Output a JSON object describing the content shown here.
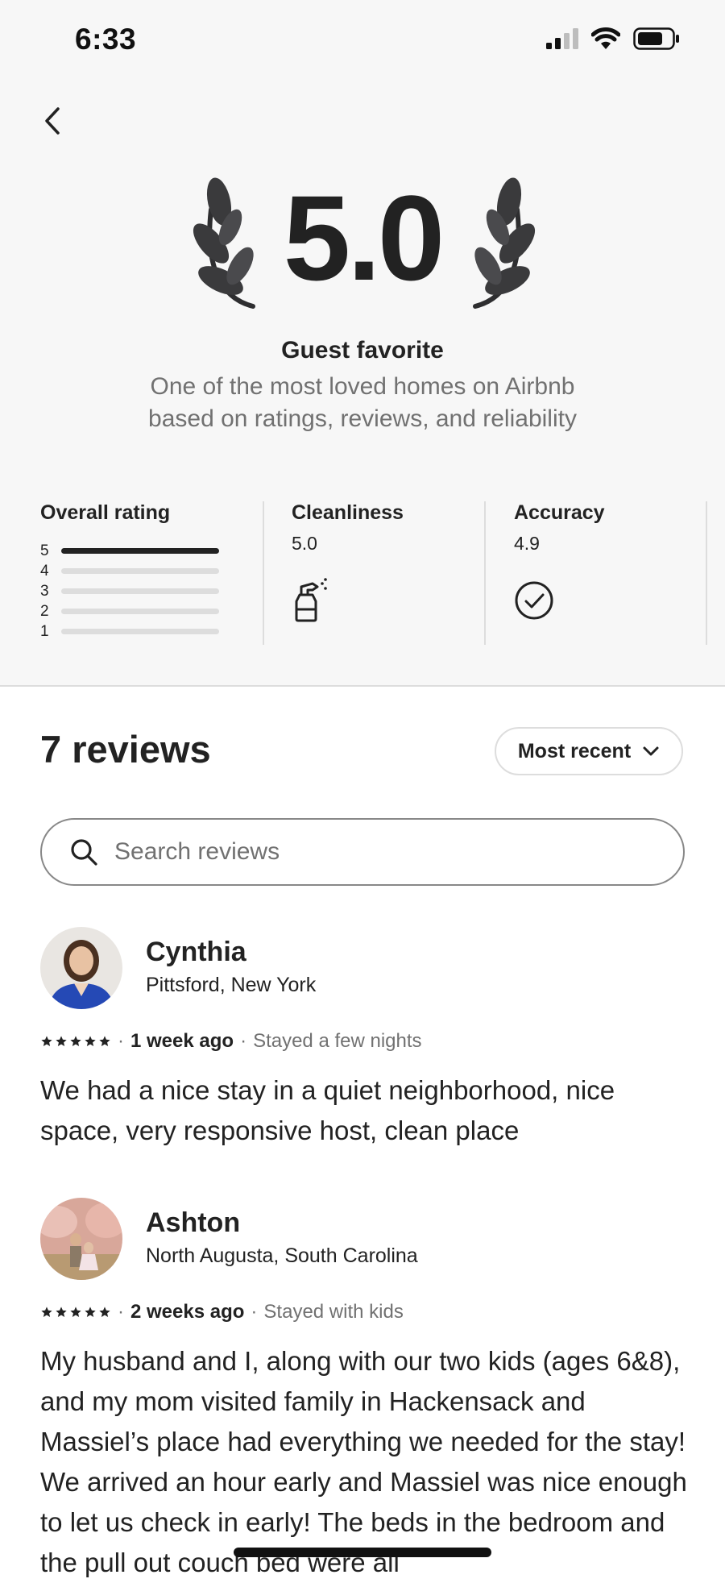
{
  "status_bar": {
    "time": "6:33"
  },
  "header": {
    "rating": "5.0",
    "badge_title": "Guest favorite",
    "badge_subtitle": "One of the most loved homes on Airbnb based on ratings, reviews, and reliability"
  },
  "categories": {
    "overall": {
      "title": "Overall rating",
      "bars": [
        {
          "label": "5",
          "fraction": 1.0
        },
        {
          "label": "4",
          "fraction": 0.0
        },
        {
          "label": "3",
          "fraction": 0.0
        },
        {
          "label": "2",
          "fraction": 0.0
        },
        {
          "label": "1",
          "fraction": 0.0
        }
      ]
    },
    "cleanliness": {
      "title": "Cleanliness",
      "value": "5.0",
      "icon": "spray-bottle-icon"
    },
    "accuracy": {
      "title": "Accuracy",
      "value": "4.9",
      "icon": "check-circle-icon"
    }
  },
  "reviews_section": {
    "count_label": "7 reviews",
    "sort_label": "Most recent",
    "search_placeholder": "Search reviews"
  },
  "reviews": [
    {
      "name": "Cynthia",
      "location": "Pittsford, New York",
      "stars": 5,
      "when": "1 week ago",
      "stay": "Stayed a few nights",
      "text": "We had a nice stay in a quiet neighborhood, nice space, very responsive host, clean place"
    },
    {
      "name": "Ashton",
      "location": "North Augusta, South Carolina",
      "stars": 5,
      "when": "2 weeks ago",
      "stay": "Stayed with kids",
      "text": "My husband and I, along with our two kids (ages 6&8), and my mom visited family in Hackensack and Massiel’s place had everything we needed for the stay! We arrived an hour early and Massiel was nice enough to let us check in early! The beds in the bedroom and the pull out couch bed were all"
    }
  ],
  "colors": {
    "text": "#222222",
    "muted": "#717171",
    "divider": "#dddddd",
    "panel_bg": "#f7f7f7"
  }
}
